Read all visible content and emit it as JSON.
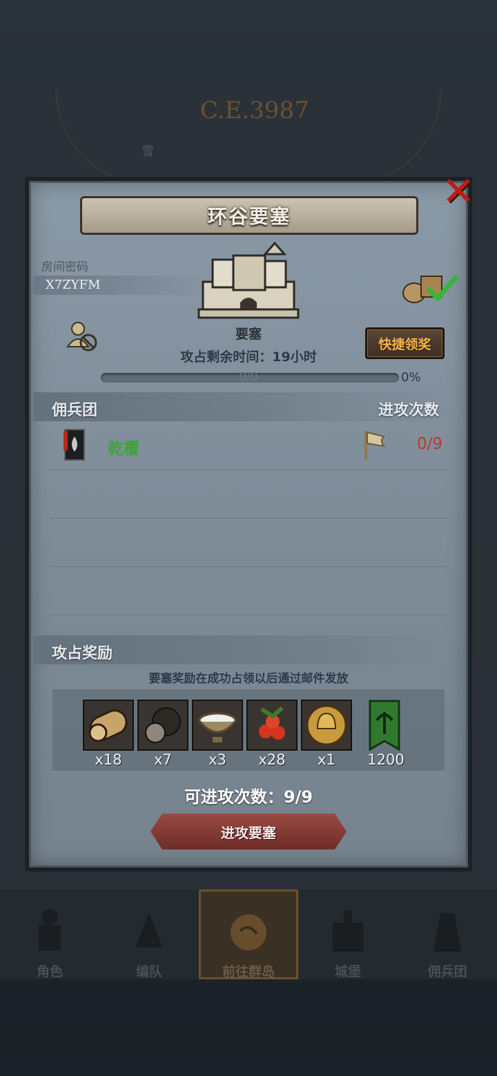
{
  "background": {
    "era_label": "C.E.3987",
    "location_label": "雪"
  },
  "dialog": {
    "title": "环谷要塞",
    "room_code_label": "房间密码",
    "room_code": "X7ZYFM",
    "building_label": "要塞",
    "quick_claim_label": "快捷领奖",
    "occupy_time_label": "攻占剩余时间：19小时",
    "progress_text": "0/0",
    "progress_percent": "0%",
    "progress_fraction": 0,
    "mercenary_section_label": "佣兵团",
    "attack_count_header": "进攻次数",
    "guild": {
      "name": "乾覆",
      "attack_count": "0/9"
    },
    "reward_section_label": "攻占奖励",
    "reward_note": "要塞奖励在成功占领以后通过邮件发放",
    "rewards": [
      {
        "icon": "wood-log-icon",
        "qty": "x18"
      },
      {
        "icon": "truffle-icon",
        "qty": "x7"
      },
      {
        "icon": "milk-bowl-icon",
        "qty": "x3"
      },
      {
        "icon": "berries-icon",
        "qty": "x28"
      },
      {
        "icon": "helmet-coin-icon",
        "qty": "x1"
      },
      {
        "icon": "guild-banner-icon",
        "qty": "1200"
      }
    ],
    "attempts_label": "可进攻次数：9/9",
    "attack_button_label": "进攻要塞"
  },
  "nav": {
    "items": [
      {
        "label": "角色",
        "icon": "knight-icon"
      },
      {
        "label": "编队",
        "icon": "formation-icon"
      },
      {
        "label": "前往群岛",
        "icon": "islands-icon"
      },
      {
        "label": "城堡",
        "icon": "castle-icon"
      },
      {
        "label": "佣兵团",
        "icon": "mercenary-icon"
      }
    ]
  },
  "colors": {
    "panel": "#7e8c98",
    "guild_name": "#3fa33b",
    "attack_count": "#b83a2c",
    "claim_text": "#f6b44c",
    "attack_button": "#8a3d36"
  }
}
